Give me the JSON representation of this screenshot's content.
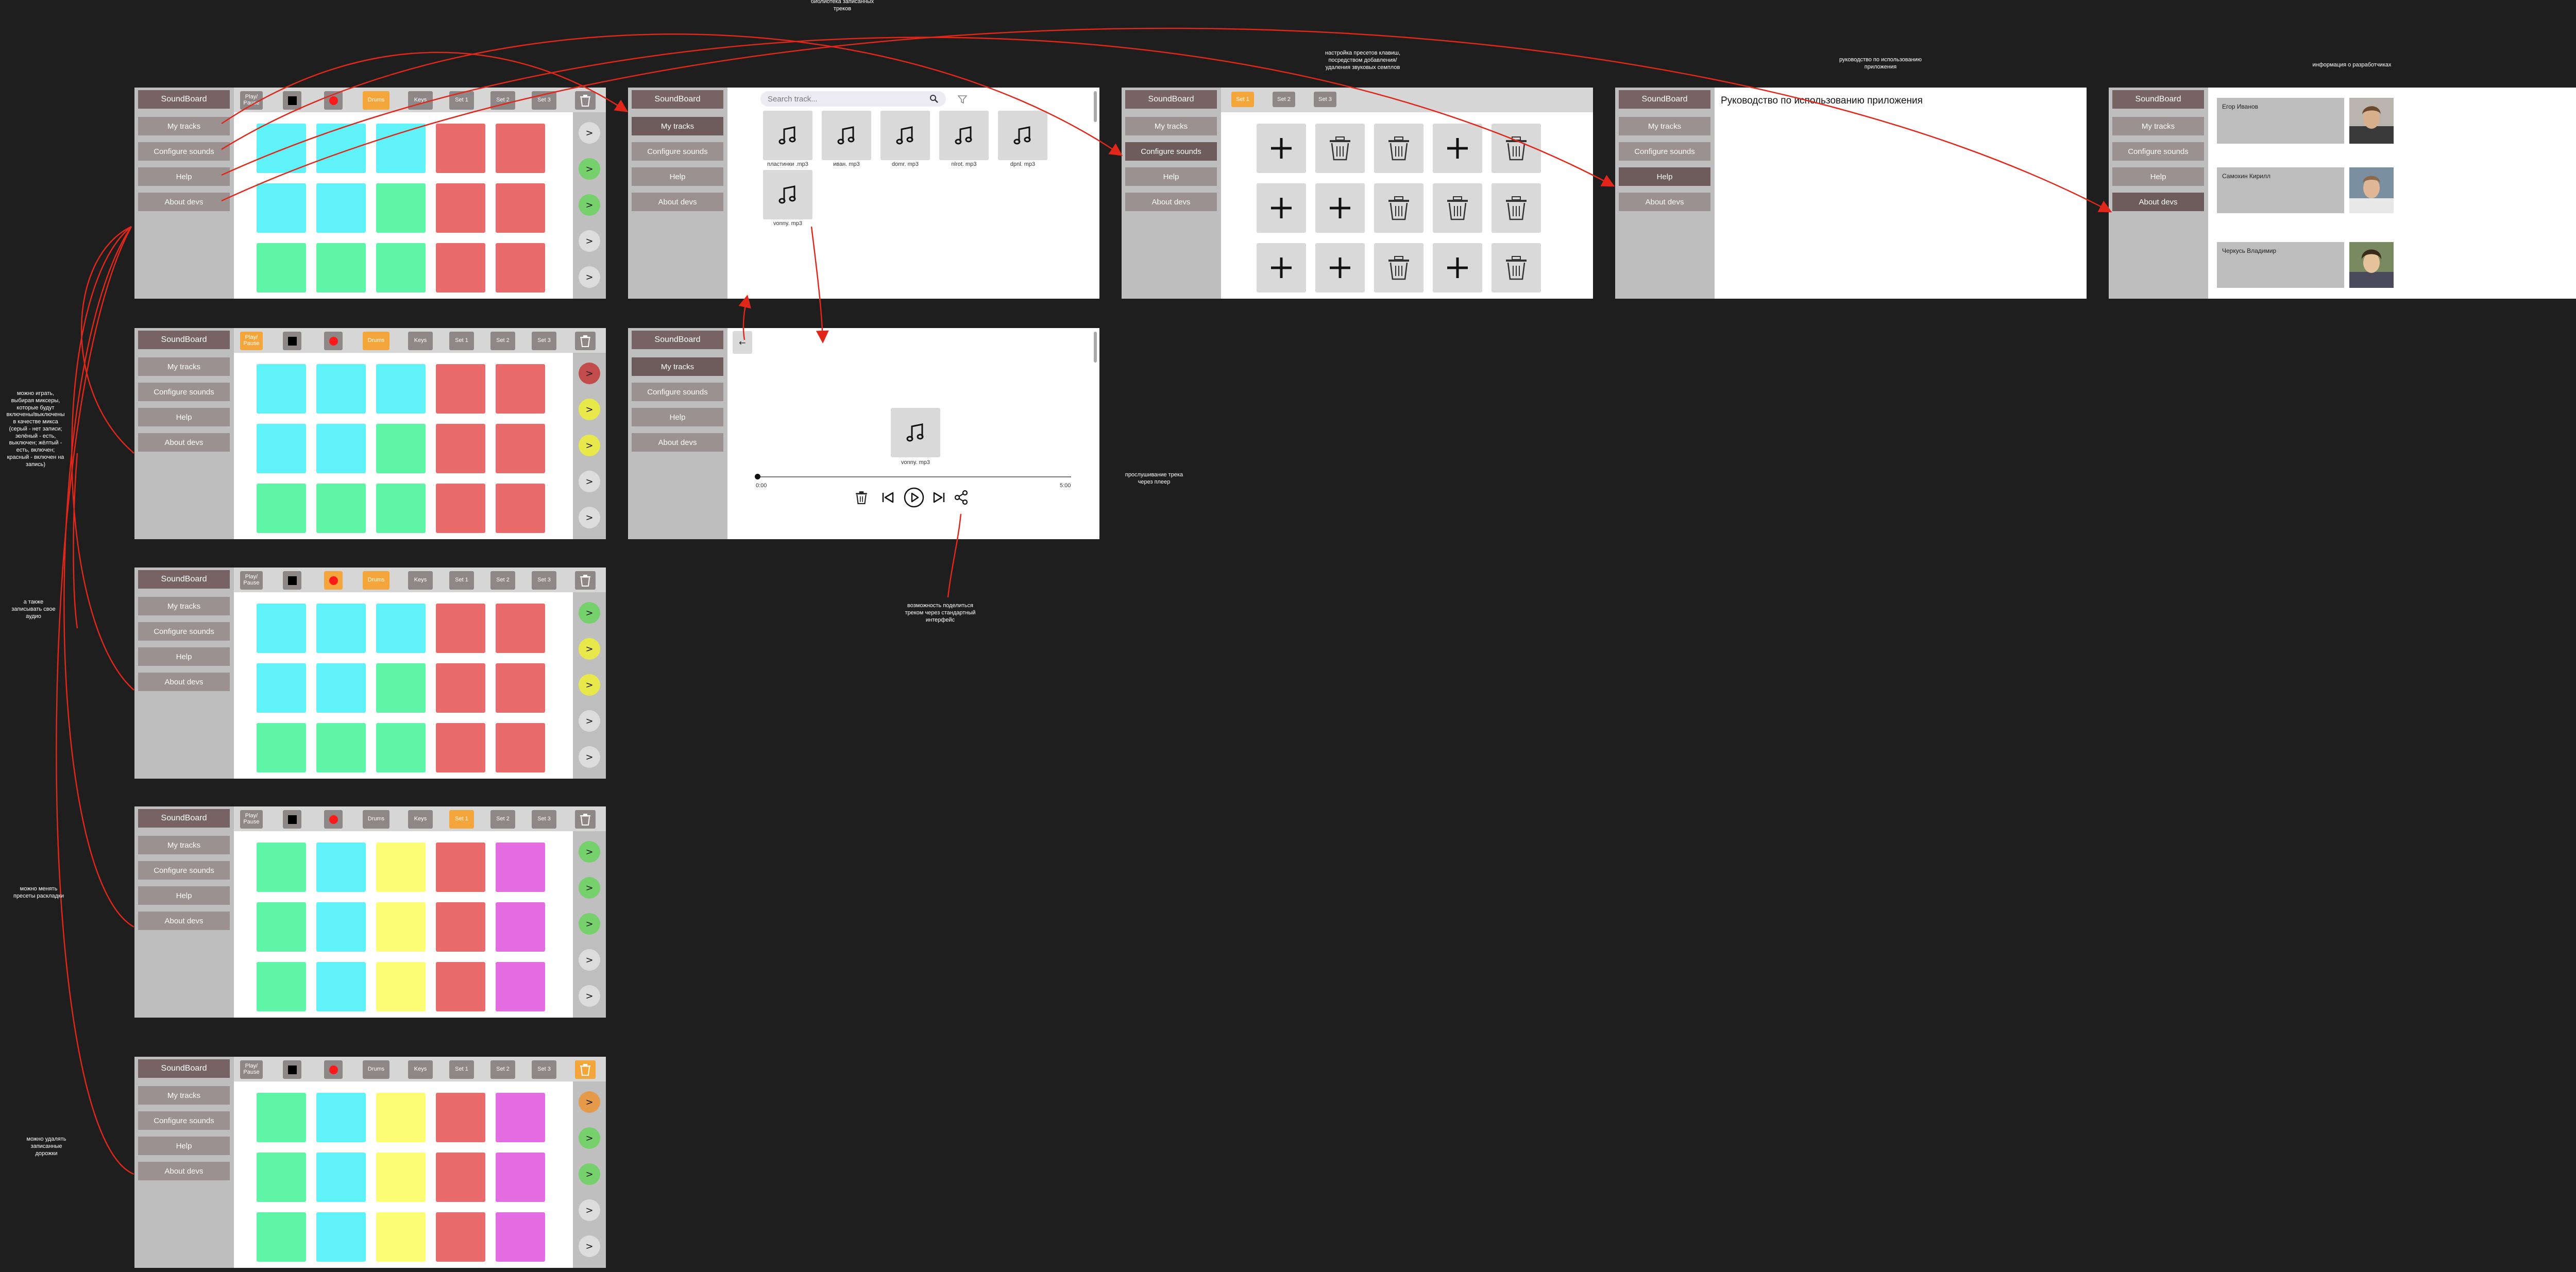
{
  "sidebar": {
    "title": "SoundBoard",
    "items": [
      "My tracks",
      "Configure sounds",
      "Help",
      "About devs"
    ]
  },
  "toolbar": {
    "play_pause": "Play/\nPause",
    "drums": "Drums",
    "keys": "Keys",
    "set1": "Set 1",
    "set2": "Set 2",
    "set3": "Set 3"
  },
  "track_button_glyph": ">",
  "colors": {
    "cyan": "#5ff2f8",
    "green": "#5ff5a6",
    "red": "#e96b6b",
    "yellow": "#fdfd75",
    "magenta": "#e56de2",
    "orange": "#f5a63a",
    "track_green": "#76d06b",
    "track_yellow": "#e8e84b",
    "track_red": "#c24b4b",
    "track_grey": "#dcdcdc",
    "arrow": "#e0271a"
  },
  "library": {
    "search_placeholder": "Search track...",
    "tracks": [
      "пластинки .mp3",
      "иван. mp3",
      "domr. mp3",
      "nlrot. mp3",
      "dpnl. mp3",
      "vonny. mp3"
    ]
  },
  "player": {
    "back_glyph": "←",
    "track_name": "vonny. mp3",
    "time_start": "0:00",
    "time_end": "5:00"
  },
  "help": {
    "heading": "Руководство по использованию приложения"
  },
  "about": {
    "devs": [
      "Егор Иванов",
      "Самохин Кирилл",
      "Черкусь Владимир"
    ]
  },
  "notes": {
    "library": "библиотека записанных\nтреков",
    "presets": "настройка пресетов клавиш,\nпосредством добавления/\nудаления звуковых семплов",
    "guide": "руководство по использованию\nприложения",
    "devs_info": "информация о разработчиках",
    "listen": "прослушивание трека\nчерез плеер",
    "share": "возможность поделиться\nтреком через стандартный\nинтерфейс",
    "play": "можно играть,\nвыбирая миксеры,\nкоторые будут\nвключены/выключены\nв качестве микса\n(серый - нет записи;\nзелёный - есть,\nвыключен; жёлтый -\nесть, включен;\nкрасный - включен на\nзапись)",
    "record": "а также\nзаписывать свое\nаудио",
    "switch_presets": "можно менять\nпресеты раскладки",
    "delete": "можно удалять\nзаписанные\nдорожки"
  }
}
